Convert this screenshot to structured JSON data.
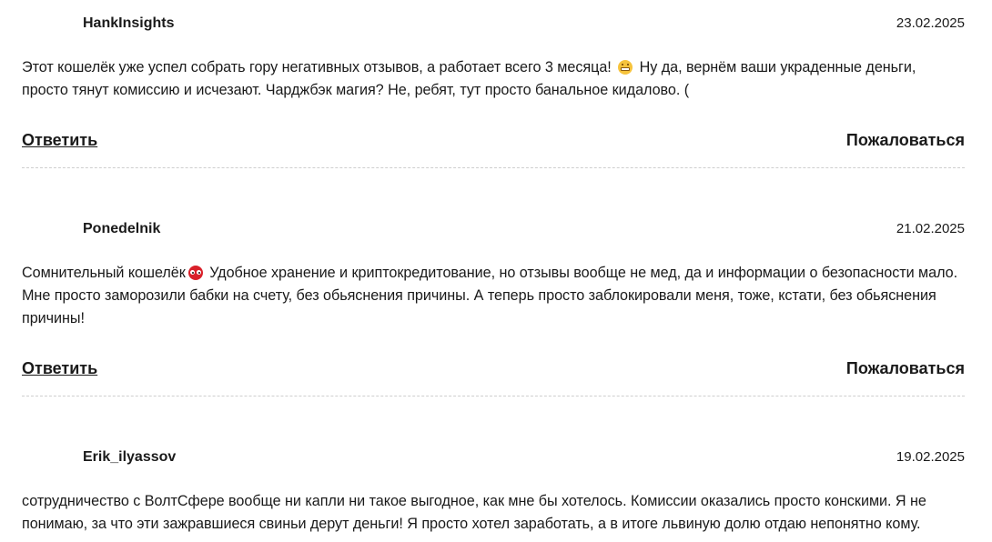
{
  "comments": [
    {
      "author": "HankInsights",
      "date": "23.02.2025",
      "text_before_emoji": "Этот кошелёк уже успел собрать гору негативных отзывов, а работает всего 3 месяца!",
      "emoji": "grimacing-face-icon",
      "text_after_emoji": "Ну да, вернём ваши украденные деньги, просто тянут комиссию и исчезают. Чарджбэк магия? Не, ребят, тут просто банальное кидалово. (",
      "reply_label": "Ответить",
      "report_label": "Пожаловаться"
    },
    {
      "author": "Ponedelnik",
      "date": "21.02.2025",
      "text_before_emoji": "Сомнительный кошелёк",
      "emoji": "masked-face-icon",
      "text_after_emoji": "Удобное хранение и криптокредитование, но отзывы вообще не мед, да и информации о безопасности мало. Мне просто заморозили бабки на счету, без обьяснения причины. А теперь просто заблокировали меня, тоже, кстати, без обьяснения причины!",
      "reply_label": "Ответить",
      "report_label": "Пожаловаться"
    },
    {
      "author": "Erik_ilyassov",
      "date": "19.02.2025",
      "text": "сотрудничество с ВолтСфере вообще ни капли ни такое выгодное, как мне бы хотелось. Комиссии оказались просто конскими. Я не понимаю, за что эти зажравшиеся свиньи дерут деньги! Я просто хотел заработать, а в итоге львиную долю отдаю непонятно кому."
    }
  ],
  "colors": {
    "text": "#1a1a1a",
    "divider": "#cfcfcf",
    "background": "#ffffff"
  }
}
